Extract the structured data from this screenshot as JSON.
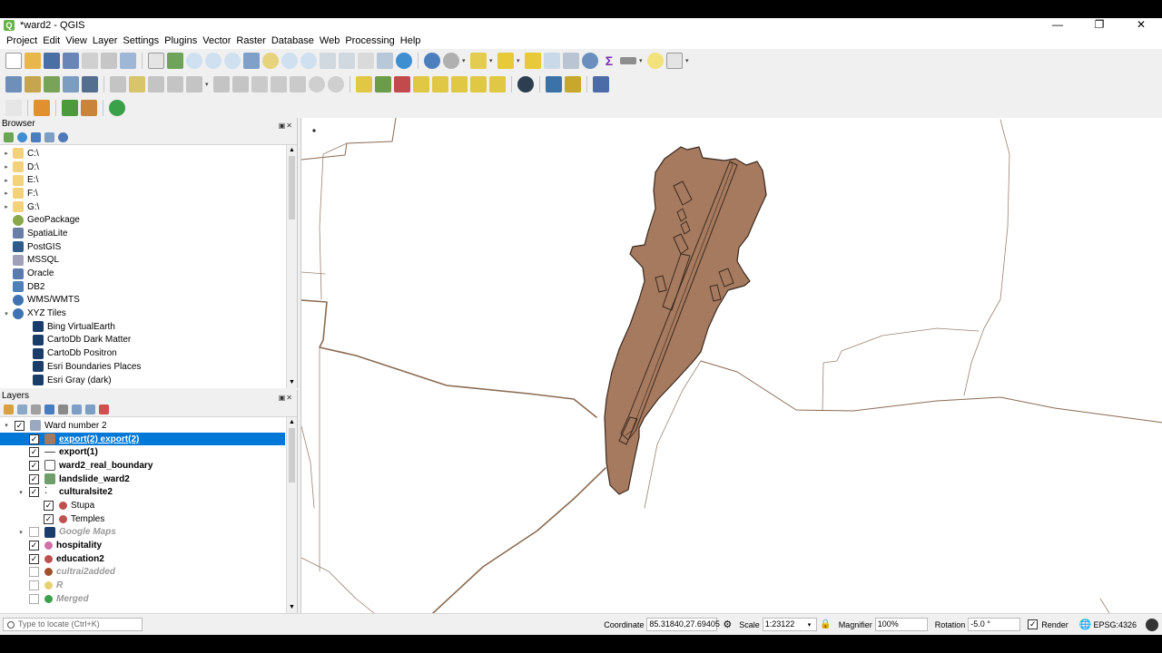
{
  "window": {
    "title": "*ward2 - QGIS",
    "app_icon_letter": "Q",
    "minimize": "—",
    "restore": "❐",
    "close": "✕"
  },
  "menu": [
    "Project",
    "Edit",
    "View",
    "Layer",
    "Settings",
    "Plugins",
    "Vector",
    "Raster",
    "Database",
    "Web",
    "Processing",
    "Help"
  ],
  "browser": {
    "title": "Browser",
    "items": [
      {
        "label": "C:\\",
        "icon": "folder-icon",
        "expand": "▸"
      },
      {
        "label": "D:\\",
        "icon": "folder-icon",
        "expand": "▸"
      },
      {
        "label": "E:\\",
        "icon": "folder-icon",
        "expand": "▸"
      },
      {
        "label": "F:\\",
        "icon": "folder-icon",
        "expand": "▸"
      },
      {
        "label": "G:\\",
        "icon": "folder-icon",
        "expand": "▸"
      },
      {
        "label": "GeoPackage",
        "icon": "geopackage-icon",
        "expand": ""
      },
      {
        "label": "SpatiaLite",
        "icon": "spatialite-icon",
        "expand": ""
      },
      {
        "label": "PostGIS",
        "icon": "postgis-icon",
        "expand": ""
      },
      {
        "label": "MSSQL",
        "icon": "mssql-icon",
        "expand": ""
      },
      {
        "label": "Oracle",
        "icon": "oracle-icon",
        "expand": ""
      },
      {
        "label": "DB2",
        "icon": "db2-icon",
        "expand": ""
      },
      {
        "label": "WMS/WMTS",
        "icon": "globe-icon",
        "expand": ""
      },
      {
        "label": "XYZ Tiles",
        "icon": "globe-icon",
        "expand": "▾"
      },
      {
        "label": "Bing VirtualEarth",
        "icon": "tile-icon",
        "expand": "",
        "child": true
      },
      {
        "label": "CartoDb Dark Matter",
        "icon": "tile-icon",
        "expand": "",
        "child": true
      },
      {
        "label": "CartoDb Positron",
        "icon": "tile-icon",
        "expand": "",
        "child": true
      },
      {
        "label": "Esri Boundaries Places",
        "icon": "tile-icon",
        "expand": "",
        "child": true
      },
      {
        "label": "Esri Gray (dark)",
        "icon": "tile-icon",
        "expand": "",
        "child": true
      }
    ]
  },
  "layers": {
    "title": "Layers",
    "items": [
      {
        "label": "Ward number 2",
        "checked": true,
        "expand": "▾",
        "level": 0,
        "style": "",
        "icon": "group-icon"
      },
      {
        "label": "export(2) export(2)",
        "checked": true,
        "expand": "",
        "level": 1,
        "style": "selected",
        "icon": "polygon-brown-icon"
      },
      {
        "label": "export(1)",
        "checked": true,
        "expand": "",
        "level": 1,
        "style": "bold",
        "icon": "line-icon"
      },
      {
        "label": "ward2_real_boundary",
        "checked": true,
        "expand": "",
        "level": 1,
        "style": "bold",
        "icon": "polygon-empty-icon"
      },
      {
        "label": "landslide_ward2",
        "checked": true,
        "expand": "",
        "level": 1,
        "style": "bold",
        "icon": "polygon-green-icon"
      },
      {
        "label": "culturalsite2",
        "checked": true,
        "expand": "▾",
        "level": 1,
        "style": "bold",
        "icon": "points-icon"
      },
      {
        "label": "Stupa",
        "checked": true,
        "expand": "",
        "level": 2,
        "style": "",
        "icon": "circle-red-icon"
      },
      {
        "label": "Temples",
        "checked": true,
        "expand": "",
        "level": 2,
        "style": "",
        "icon": "circle-red-icon"
      },
      {
        "label": "Google Maps",
        "checked": false,
        "expand": "▾",
        "level": 1,
        "style": "grey",
        "icon": "tile-icon"
      },
      {
        "label": "hospitality",
        "checked": true,
        "expand": "",
        "level": 1,
        "style": "bold",
        "icon": "circle-pink-icon"
      },
      {
        "label": "education2",
        "checked": true,
        "expand": "",
        "level": 1,
        "style": "bold",
        "icon": "circle-red-icon"
      },
      {
        "label": "cultrai2added",
        "checked": false,
        "expand": "",
        "level": 1,
        "style": "grey",
        "icon": "dot-brown-icon"
      },
      {
        "label": "R",
        "checked": false,
        "expand": "",
        "level": 1,
        "style": "grey",
        "icon": "dot-yellow-icon"
      },
      {
        "label": "Merged",
        "checked": false,
        "expand": "",
        "level": 1,
        "style": "grey",
        "icon": "circle-green-icon"
      }
    ]
  },
  "status": {
    "locate_placeholder": "Type to locate (Ctrl+K)",
    "coordinate_label": "Coordinate",
    "coordinate_value": "85.31840,27.69405",
    "scale_label": "Scale",
    "scale_value": "1:23122",
    "magnifier_label": "Magnifier",
    "magnifier_value": "100%",
    "rotation_label": "Rotation",
    "rotation_value": "-5.0 °",
    "render_label": "Render",
    "crs_value": "EPSG:4326"
  },
  "colors": {
    "polygon_fill": "#a67a5e",
    "polygon_stroke": "#3a2a20",
    "road": "#8a6b52",
    "selection": "#0078d7"
  }
}
